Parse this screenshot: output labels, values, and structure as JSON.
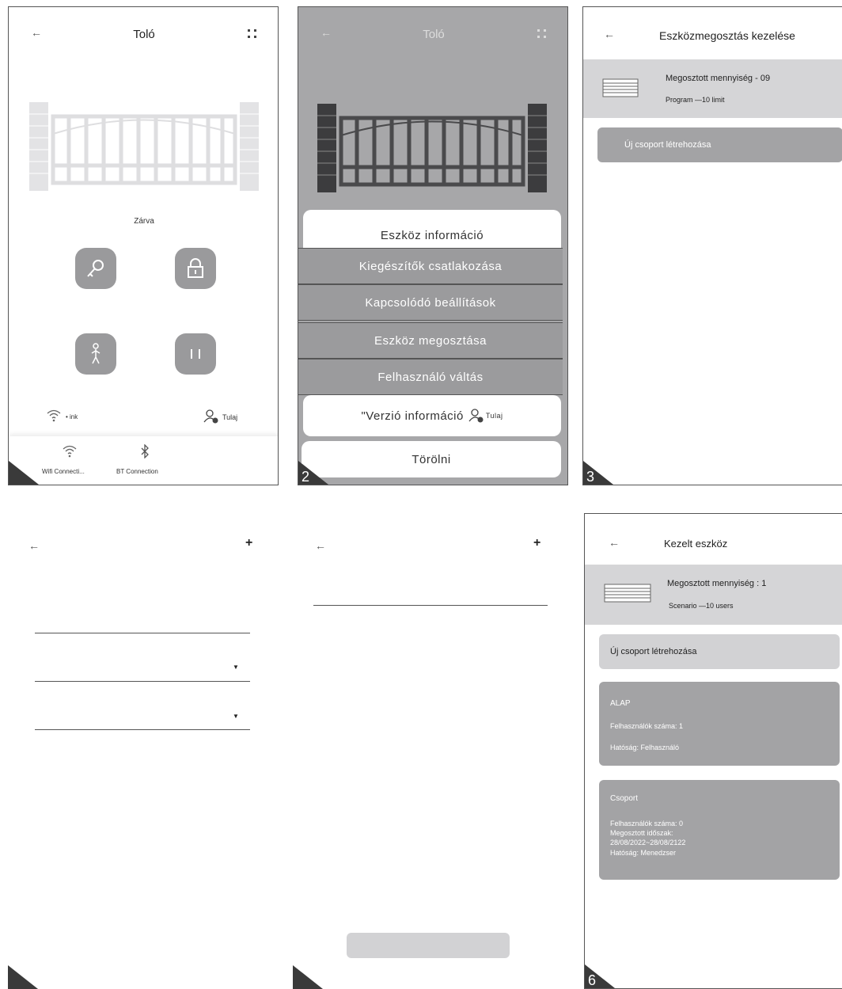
{
  "screen1": {
    "back": "←",
    "title": "Toló",
    "status": "Zárva",
    "link_text": "• ink",
    "owner": "Tulaj",
    "nav_wifi": "Wifi Connecti...",
    "nav_bt": "BT Connection"
  },
  "screen2": {
    "back": "←",
    "title": "Toló",
    "menu": {
      "item1": "Eszköz információ",
      "item2": "Kiegészítők csatlakozása",
      "item3": "Kapcsolódó beállítások",
      "item4": "Eszköz megosztása",
      "item5": "Felhasználó váltás",
      "item6": "\"Verzió információ",
      "item6_owner": "Tulaj",
      "delete": "Törölni"
    },
    "corner": "2"
  },
  "screen3": {
    "back": "←",
    "title": "Eszközmegosztás kezelése",
    "shared_qty": "Megosztott mennyiség - 09",
    "program": "Program —10 limit",
    "new_group": "Új csoport létrehozása",
    "corner": "3"
  },
  "screen4": {
    "back": "←",
    "plus": "+"
  },
  "screen5": {
    "back": "←",
    "plus": "+"
  },
  "screen6": {
    "back": "←",
    "title": "Kezelt eszköz",
    "shared_qty": "Megosztott mennyiség : 1",
    "scenario": "Scenario —10 users",
    "new_group": "Új csoport létrehozása",
    "group1": {
      "name": "ALAP",
      "users": "Felhasználók száma: 1",
      "authority": "Hatóság: Felhasználó"
    },
    "group2": {
      "name": "Csoport",
      "users": "Felhasználók száma: 0",
      "period_label": "Megosztott időszak:",
      "period": "28/08/2022~28/08/2122",
      "authority": "Hatóság: Menedzser"
    },
    "corner": "6"
  },
  "colors": {
    "gray_bg": "#a7a7a9",
    "button_gray": "#9a9a9c",
    "card_dark": "#a3a3a5",
    "card_light": "#d2d2d4"
  }
}
